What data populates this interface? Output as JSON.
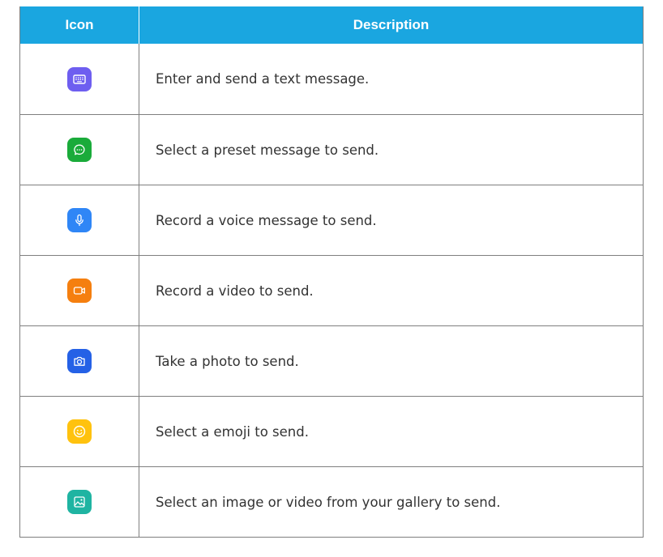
{
  "table": {
    "headers": {
      "icon": "Icon",
      "description": "Description"
    },
    "rows": [
      {
        "icon": "keyboard-icon",
        "color": "#6e5ef0",
        "description": "Enter and send a text message."
      },
      {
        "icon": "chat-bubble-icon",
        "color": "#1aab3a",
        "description": "Select a preset message to send."
      },
      {
        "icon": "microphone-icon",
        "color": "#2f86f6",
        "description": "Record a voice message to send."
      },
      {
        "icon": "video-camera-icon",
        "color": "#f57f0f",
        "description": "Record a video to send."
      },
      {
        "icon": "camera-icon",
        "color": "#2561e6",
        "description": "Take a photo to send."
      },
      {
        "icon": "emoji-icon",
        "color": "#ffc20e",
        "description": "Select a emoji to send."
      },
      {
        "icon": "gallery-icon",
        "color": "#1fb4a2",
        "description": "Select an image or video from your gallery to send."
      }
    ]
  }
}
